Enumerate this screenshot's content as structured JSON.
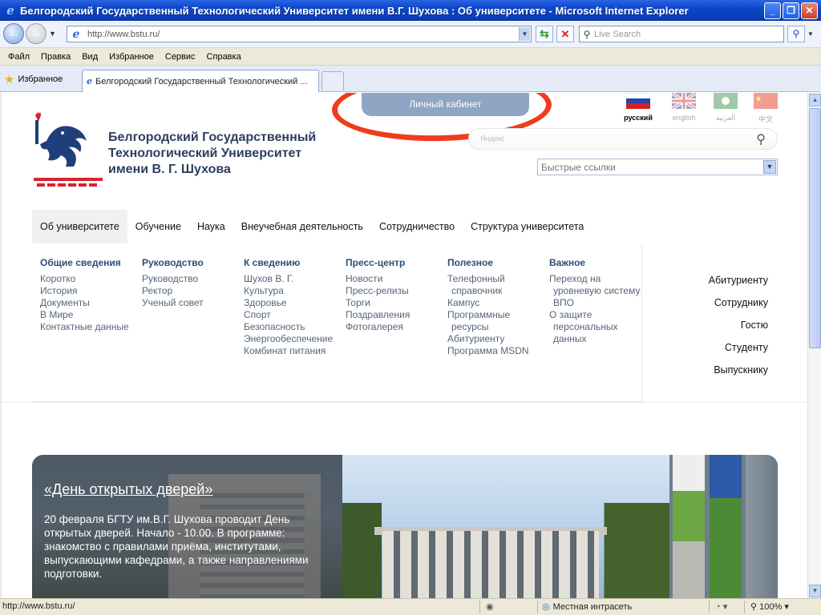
{
  "window": {
    "title": "Белгородский Государственный Технологический Университет имени В.Г. Шухова : Об университете - Microsoft Internet Explorer"
  },
  "address_bar": {
    "url": "http://www.bstu.ru/",
    "search_placeholder": "Live Search"
  },
  "menu": [
    "Файл",
    "Правка",
    "Вид",
    "Избранное",
    "Сервис",
    "Справка"
  ],
  "favorites_label": "Избранное",
  "tab": {
    "title": "Белгородский Государственный Технологический ..."
  },
  "page": {
    "cabinet_label": "Личный кабинет",
    "university_name": [
      "Белгородский Государственный",
      "Технологический Университет",
      "имени В. Г. Шухова"
    ],
    "languages": [
      {
        "label": "русский",
        "active": true
      },
      {
        "label": "english",
        "active": false
      },
      {
        "label": "العربية",
        "active": false
      },
      {
        "label": "中文",
        "active": false
      }
    ],
    "search_placeholder": "Яндекс",
    "quick_links_label": "Быстрые ссылки",
    "main_nav": [
      "Об университете",
      "Обучение",
      "Наука",
      "Внеучебная деятельность",
      "Сотрудничество",
      "Структура университета"
    ],
    "columns": [
      {
        "title": "Общие сведения",
        "links": [
          "Коротко",
          "История",
          "Документы",
          "В Мире",
          "Контактные данные"
        ]
      },
      {
        "title": "Руководство",
        "links": [
          "Руководство",
          "Ректор",
          "Ученый совет"
        ]
      },
      {
        "title": "К сведению",
        "links": [
          "Шухов В. Г.",
          "Культура",
          "Здоровье",
          "Спорт",
          "Безопасность",
          "Энергообеспечение",
          "Комбинат питания"
        ]
      },
      {
        "title": "Пресс-центр",
        "links": [
          "Новости",
          "Пресс-релизы",
          "Торги",
          "Поздравления",
          "Фотогалерея"
        ]
      },
      {
        "title": "Полезное",
        "links": [
          "Телефонный",
          "справочник",
          "Кампус",
          "Программные",
          "ресурсы",
          "Абитуриенту",
          "Программа MSDN"
        ]
      },
      {
        "title": "Важное",
        "links": [
          "Переход на",
          "уровневую систему",
          "ВПО",
          "О защите",
          "персональных",
          "данных"
        ]
      }
    ],
    "audience": [
      "Абитуриенту",
      "Сотруднику",
      "Гостю",
      "Студенту",
      "Выпускнику"
    ],
    "banner": {
      "title": "«День открытых дверей»",
      "text": "20 февраля БГТУ им.В.Г. Шухова проводит День открытых дверей. Начало - 10.00. В программе: знакомство с правилами приёма, институтами, выпускающими кафедрами, а также направлениями подготовки."
    }
  },
  "status": {
    "url": "http://www.bstu.ru/",
    "zone": "Местная интрасеть",
    "zoom": "100%"
  },
  "colors": {
    "annotation_circle": "#ee3c1d",
    "cabinet_button": "#8fa5c4",
    "column_heading": "#2c4e78",
    "logo_red": "#d9232e",
    "logo_blue": "#1e3f7a"
  }
}
